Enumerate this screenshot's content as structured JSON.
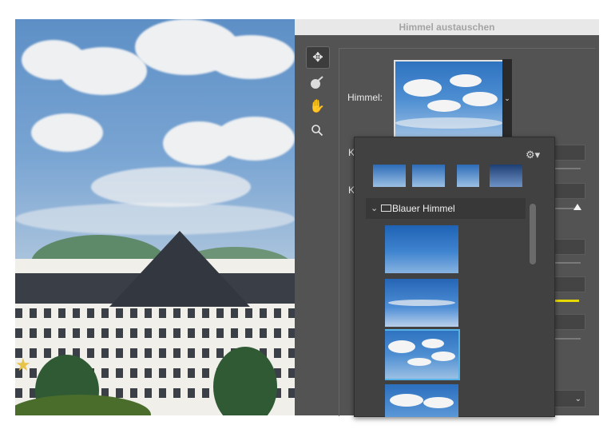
{
  "panel": {
    "title": "Himmel austauschen",
    "sky_label": "Himmel:",
    "truncated_labels": [
      "K",
      "K"
    ],
    "gear_icon": "gear-icon",
    "folder": {
      "label": "Blauer Himmel",
      "expanded": true
    },
    "tools": [
      "move-icon",
      "brush-icon",
      "hand-icon",
      "zoom-icon"
    ],
    "accent": "#55b3e8"
  }
}
